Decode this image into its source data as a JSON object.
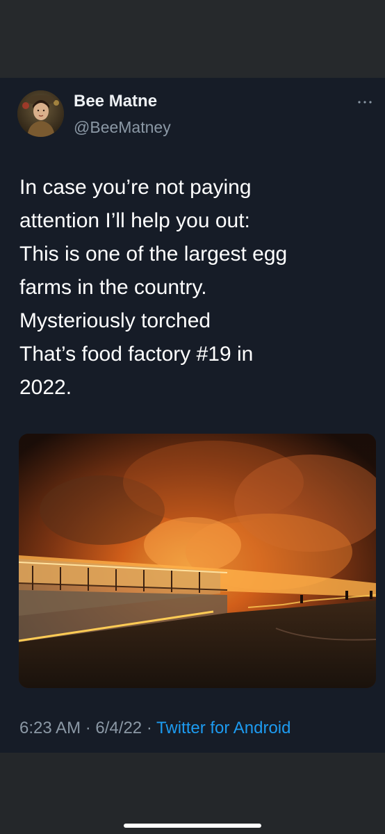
{
  "tweet": {
    "display_name": "Bee Matne",
    "handle": "@BeeMatney",
    "lines": [
      "In case you’re not paying",
      "attention I’ll help you out:",
      "This is one of the largest egg",
      "farms in the country.",
      "Mysteriously torched",
      "That’s food factory #19 in",
      "2022."
    ],
    "time": "6:23 AM",
    "date": "6/4/22",
    "separator": "·",
    "source": "Twitter for Android"
  },
  "icons": {
    "avatar": "avatar-photo",
    "more": "more-options-icon"
  },
  "colors": {
    "background": "#24272a",
    "card": "#161c27",
    "text": "#ffffff",
    "secondary_text": "#8b98a5",
    "link": "#1d9bf0"
  }
}
